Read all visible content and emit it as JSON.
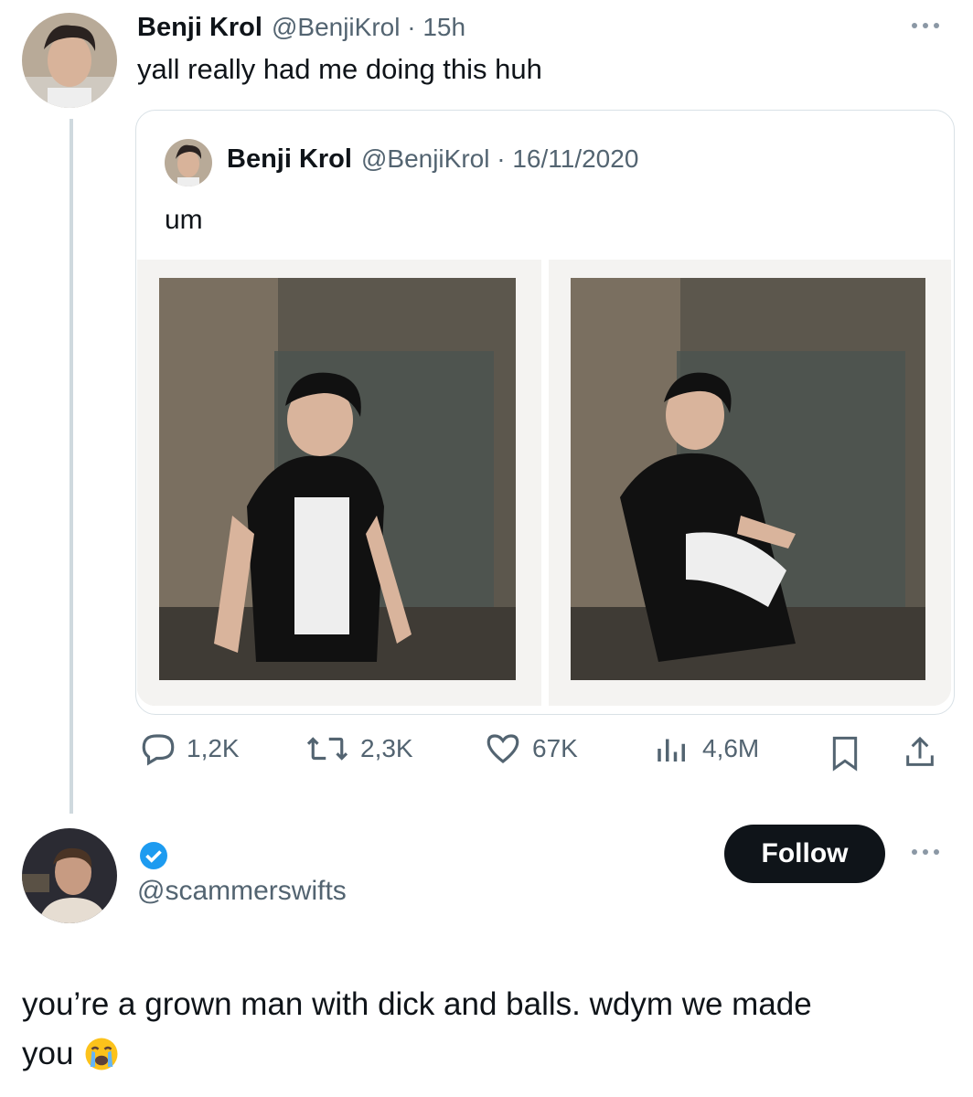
{
  "tweet": {
    "author_name": "Benji Krol",
    "handle_time": "@BenjiKrol · 15h",
    "text": "yall really had me doing this huh"
  },
  "quoted": {
    "author_name": "Benji Krol",
    "handle_time": "@BenjiKrol · 16/11/2020",
    "text": "um"
  },
  "actions": {
    "replies": "1,2K",
    "retweets": "2,3K",
    "likes": "67K",
    "views": "4,6M"
  },
  "reply": {
    "handle": "@scammerswifts",
    "follow_label": "Follow",
    "text_line1": "you’re a grown man with dick and balls. wdym we made",
    "text_line2": "you"
  },
  "colors": {
    "verified": "#1d9bf0",
    "muted": "#536471",
    "follow_bg": "#0f1419"
  },
  "icons": [
    "more-icon",
    "reply-icon",
    "retweet-icon",
    "like-icon",
    "views-icon",
    "bookmark-icon",
    "share-icon",
    "verified-badge-icon",
    "crying-emoji-icon"
  ]
}
